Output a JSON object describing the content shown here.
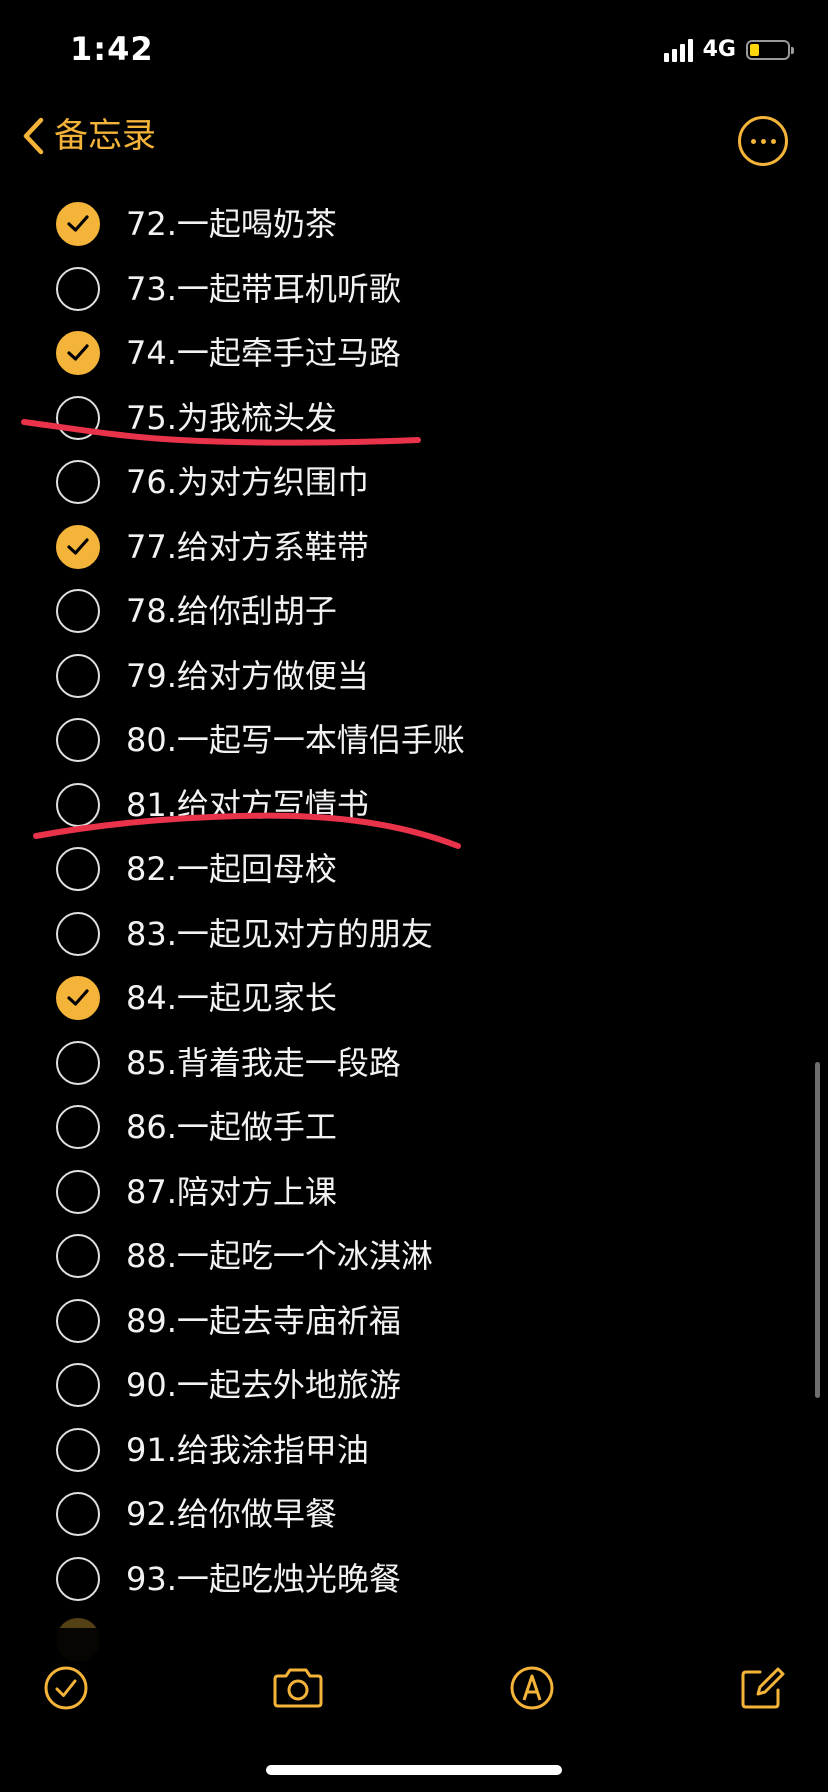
{
  "status_bar": {
    "time": "1:42",
    "network": "4G",
    "battery_level": 0.25
  },
  "nav": {
    "back_label": "备忘录",
    "back_icon": "chevron-left-icon",
    "more_icon": "ellipsis-circle-icon"
  },
  "colors": {
    "accent": "#f4b43a",
    "annotation": "#e8334a",
    "background": "#000000"
  },
  "checklist": {
    "items": [
      {
        "text": "72.一起喝奶茶",
        "checked": true
      },
      {
        "text": "73.一起带耳机听歌",
        "checked": false
      },
      {
        "text": "74.一起牵手过马路",
        "checked": true
      },
      {
        "text": "75.为我梳头发",
        "checked": false
      },
      {
        "text": "76.为对方织围巾",
        "checked": false
      },
      {
        "text": "77.给对方系鞋带",
        "checked": true
      },
      {
        "text": "78.给你刮胡子",
        "checked": false
      },
      {
        "text": "79.给对方做便当",
        "checked": false
      },
      {
        "text": "80.一起写一本情侣手账",
        "checked": false
      },
      {
        "text": "81.给对方写情书",
        "checked": false
      },
      {
        "text": "82.一起回母校",
        "checked": false
      },
      {
        "text": "83.一起见对方的朋友",
        "checked": false
      },
      {
        "text": "84.一起见家长",
        "checked": true
      },
      {
        "text": "85.背着我走一段路",
        "checked": false
      },
      {
        "text": "86.一起做手工",
        "checked": false
      },
      {
        "text": "87.陪对方上课",
        "checked": false
      },
      {
        "text": "88.一起吃一个冰淇淋",
        "checked": false
      },
      {
        "text": "89.一起去寺庙祈福",
        "checked": false
      },
      {
        "text": "90.一起去外地旅游",
        "checked": false
      },
      {
        "text": "91.给我涂指甲油",
        "checked": false
      },
      {
        "text": "92.给你做早餐",
        "checked": false
      },
      {
        "text": "93.一起吃烛光晚餐",
        "checked": false
      }
    ]
  },
  "toolbar": {
    "buttons": [
      {
        "name": "checklist-button",
        "icon": "checkmark-circle-icon"
      },
      {
        "name": "camera-button",
        "icon": "camera-icon"
      },
      {
        "name": "markup-button",
        "icon": "pen-tip-circle-icon"
      },
      {
        "name": "compose-button",
        "icon": "compose-icon"
      }
    ]
  }
}
